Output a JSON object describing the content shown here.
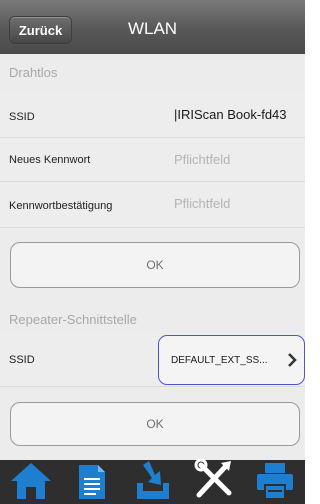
{
  "header": {
    "back_label": "Zurück",
    "title": "WLAN"
  },
  "wireless": {
    "section_title": "Drahtlos",
    "rows": [
      {
        "label": "SSID",
        "value": "IRIScan Book-fd43"
      },
      {
        "label": "Neues Kennwort",
        "placeholder": "Pflichtfeld"
      },
      {
        "label": "Kennwortbestätigung",
        "placeholder": "Pflichtfeld"
      }
    ],
    "ok_label": "OK"
  },
  "repeater": {
    "section_title": "Repeater-Schnittstelle",
    "ssid_label": "SSID",
    "ssid_value": "DEFAULT_EXT_SS...",
    "ok_label": "OK"
  },
  "colors": {
    "accent": "#1e7fd0",
    "select_border": "#4a58c9",
    "header": "#555555"
  },
  "tabbar": [
    "home-icon",
    "document-icon",
    "download-icon",
    "tools-icon",
    "printer-icon"
  ]
}
